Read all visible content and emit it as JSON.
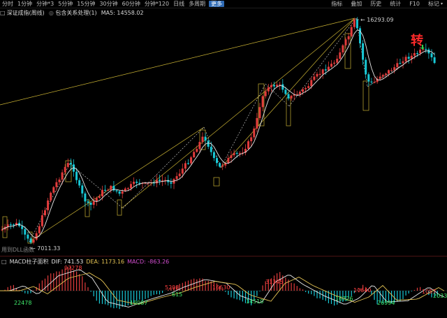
{
  "toolbar": {
    "items": [
      "分时",
      "1分钟",
      "分钟*3",
      "5分钟",
      "15分钟",
      "30分钟",
      "60分钟",
      "分钟*120",
      "日线",
      "多周期"
    ],
    "more": "更多",
    "right_items": [
      "指标",
      "叠加",
      "历史",
      "统计",
      "F10",
      "标记"
    ]
  },
  "info": {
    "name": "深证成指(周线)",
    "indicator": "包含关系处理(1)",
    "ma": "MA5: 14558.02"
  },
  "annotations": {
    "high": "16293.09",
    "low": "7011.33",
    "big_char": "转",
    "bottom_left": "用到DLL函数"
  },
  "macd": {
    "name": "MACD柱子面积",
    "dif": "DIF: 741.53",
    "dea": "DEA: 1173.16",
    "macd": "MACD: -863.26",
    "labels": [
      {
        "text": "97278",
        "color": "#ff4040"
      },
      {
        "text": "22478",
        "color": "#3fe86a"
      },
      {
        "text": "19087",
        "color": "#3fe86a"
      },
      {
        "text": "5208",
        "color": "#ff4040"
      },
      {
        "text": "615",
        "color": "#3fe86a"
      },
      {
        "text": "16630",
        "color": "#ff4040"
      },
      {
        "text": "14510",
        "color": "#3fe86a"
      },
      {
        "text": "31345",
        "color": "#ff4040"
      },
      {
        "text": "16726",
        "color": "#3fe86a"
      },
      {
        "text": "11640",
        "color": "#ff4040"
      },
      {
        "text": "26994",
        "color": "#3fe86a"
      },
      {
        "text": "1057",
        "color": "#ff4040"
      },
      {
        "text": "2033",
        "color": "#3fe86a"
      }
    ]
  },
  "colors": {
    "up": "#e23c3c",
    "down": "#18c9d6",
    "ma": "#e8e8e8",
    "trend": "#c9b233",
    "box": "#c9b233",
    "dif": "#e9e9e9",
    "dea": "#e5c454"
  }
}
